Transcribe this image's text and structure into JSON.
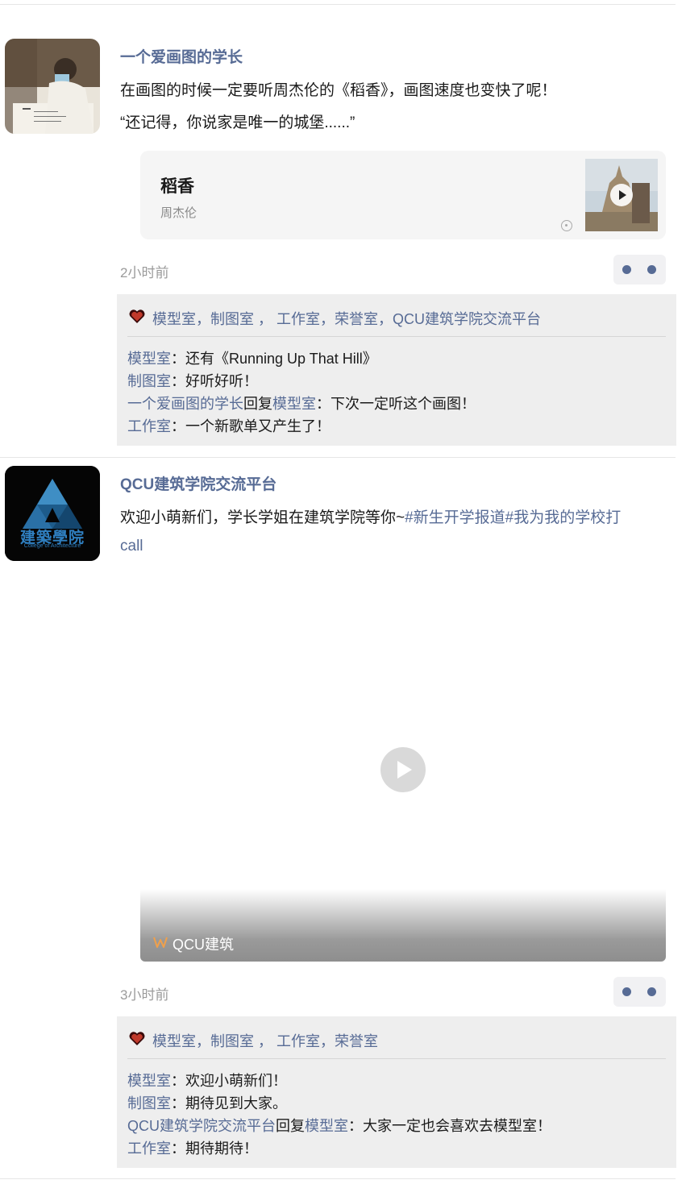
{
  "posts": [
    {
      "author": "一个爱画图的学长",
      "lines": [
        "在画图的时候一定要听周杰伦的《稻香》，画图速度也变快了呢！",
        "“还记得，你说家是唯一的城堡......”"
      ],
      "music": {
        "title": "稻香",
        "artist": "周杰伦"
      },
      "time": "2小时前",
      "likes": "模型室，制图室 ， 工作室，荣誉室，QCU建筑学院交流平台",
      "comments": [
        {
          "user": "模型室",
          "text": "：还有《Running Up That Hill》"
        },
        {
          "user": "制图室",
          "text": "：好听好听！"
        },
        {
          "user": "一个爱画图的学长",
          "reply_word": "回复",
          "reply_to": "模型室",
          "text": "：下次一定听这个画图！"
        },
        {
          "user": "工作室",
          "text": "：一个新歌单又产生了！"
        }
      ]
    },
    {
      "author": "QCU建筑学院交流平台",
      "avatar_text": "建築學院",
      "avatar_subtext": "College of Architecture",
      "text_plain": "欢迎小萌新们，学长学姐在建筑学院等你~",
      "text_tags": "#新生开学报道#我为我的学校打",
      "text_line2": "call",
      "video_label": "QCU建筑",
      "time": "3小时前",
      "likes": "模型室，制图室 ， 工作室，荣誉室",
      "comments": [
        {
          "user": "模型室",
          "text": "：欢迎小萌新们！"
        },
        {
          "user": "制图室",
          "text": "：期待见到大家。"
        },
        {
          "user": "QCU建筑学院交流平台",
          "reply_word": "回复",
          "reply_to": "模型室",
          "text": "：大家一定也会喜欢去模型室！"
        },
        {
          "user": "工作室",
          "text": "：期待期待！"
        }
      ]
    }
  ],
  "colors": {
    "link": "#576b95",
    "comment_bg": "#eeeeee",
    "heart": "#8b1a1a"
  },
  "icons": [
    "like-heart-icon",
    "play-icon",
    "music-note-icon",
    "more-dots-icon",
    "video-channel-icon"
  ]
}
